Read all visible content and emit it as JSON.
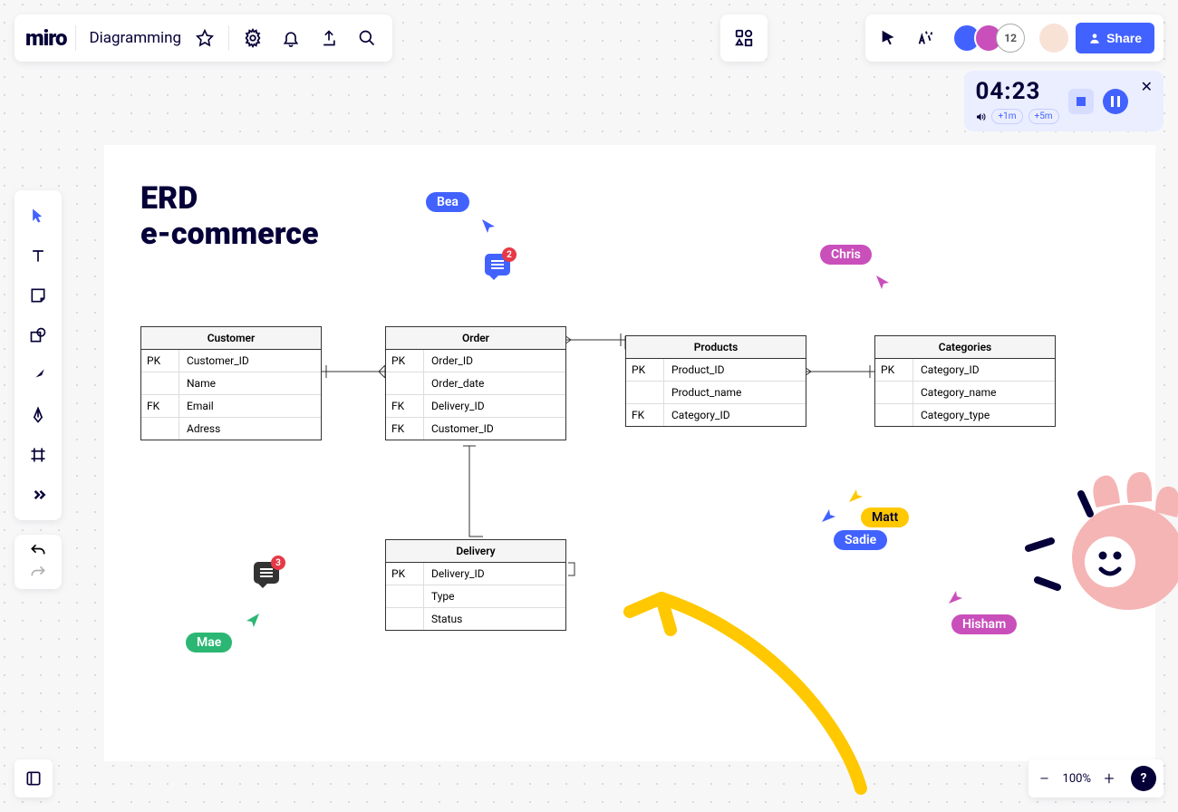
{
  "logo": "miro",
  "board_name": "Diagramming",
  "share_label": "Share",
  "avatar_count": "12",
  "timer": {
    "time": "04:23",
    "plus1": "+1m",
    "plus5": "+5m"
  },
  "zoom": "100%",
  "help": "?",
  "title_line1": "ERD",
  "title_line2": "e-commerce",
  "cursors": {
    "bea": "Bea",
    "chris": "Chris",
    "mae": "Mae",
    "sadie": "Sadie",
    "matt": "Matt",
    "hisham": "Hisham"
  },
  "comments": {
    "c1": "2",
    "c2": "3"
  },
  "tables": {
    "customer": {
      "name": "Customer",
      "rows": [
        {
          "k": "PK",
          "v": "Customer_ID"
        },
        {
          "k": "",
          "v": "Name"
        },
        {
          "k": "FK",
          "v": "Email"
        },
        {
          "k": "",
          "v": "Adress"
        }
      ]
    },
    "order": {
      "name": "Order",
      "rows": [
        {
          "k": "PK",
          "v": "Order_ID"
        },
        {
          "k": "",
          "v": "Order_date"
        },
        {
          "k": "FK",
          "v": "Delivery_ID"
        },
        {
          "k": "FK",
          "v": "Customer_ID"
        }
      ]
    },
    "products": {
      "name": "Products",
      "rows": [
        {
          "k": "PK",
          "v": "Product_ID"
        },
        {
          "k": "",
          "v": "Product_name"
        },
        {
          "k": "FK",
          "v": "Category_ID"
        }
      ]
    },
    "categories": {
      "name": "Categories",
      "rows": [
        {
          "k": "PK",
          "v": "Category_ID"
        },
        {
          "k": "",
          "v": "Category_name"
        },
        {
          "k": "",
          "v": "Category_type"
        }
      ]
    },
    "delivery": {
      "name": "Delivery",
      "rows": [
        {
          "k": "PK",
          "v": "Delivery_ID"
        },
        {
          "k": "",
          "v": "Type"
        },
        {
          "k": "",
          "v": "Status"
        }
      ]
    }
  }
}
